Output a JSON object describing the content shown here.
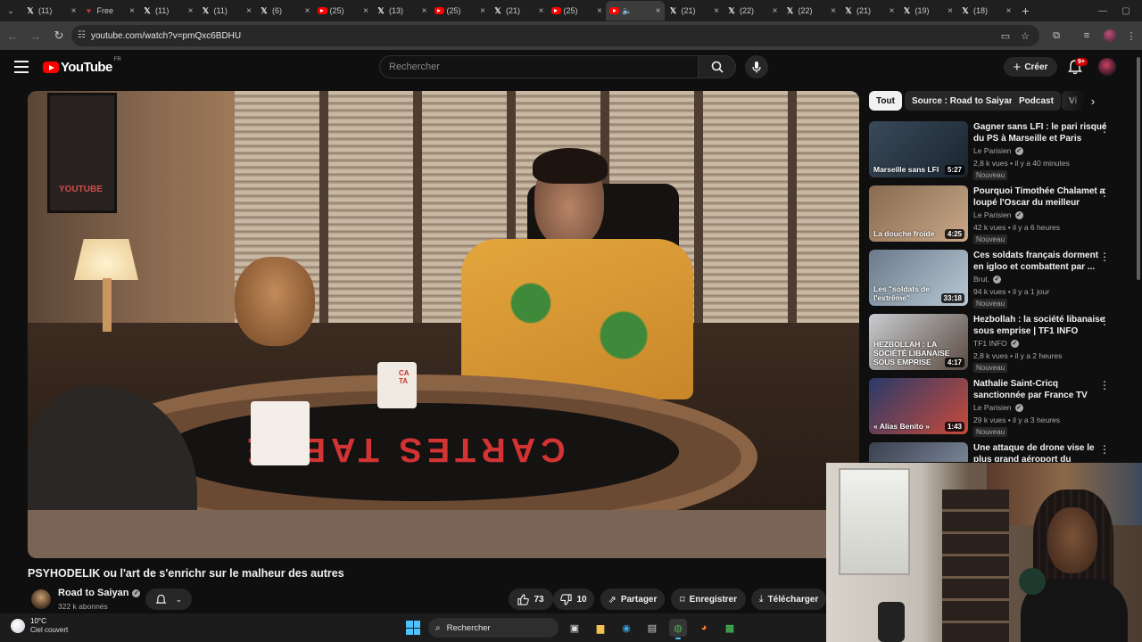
{
  "browser": {
    "tabs": [
      {
        "icon": "x-logo-icon",
        "label": "(11)"
      },
      {
        "icon": "heart-icon",
        "label": "Free"
      },
      {
        "icon": "x-logo-icon",
        "label": "(11)"
      },
      {
        "icon": "x-logo-icon",
        "label": "(11)"
      },
      {
        "icon": "x-logo-icon",
        "label": "(6)"
      },
      {
        "icon": "youtube-icon",
        "label": "(25)"
      },
      {
        "icon": "x-logo-icon",
        "label": "(13)"
      },
      {
        "icon": "youtube-icon",
        "label": "(25)"
      },
      {
        "icon": "x-logo-icon",
        "label": "(21)"
      },
      {
        "icon": "youtube-icon",
        "label": "(25)"
      },
      {
        "icon": "youtube-icon",
        "label": "",
        "active": true
      },
      {
        "icon": "x-logo-icon",
        "label": "(21)"
      },
      {
        "icon": "x-logo-icon",
        "label": "(22)"
      },
      {
        "icon": "x-logo-icon",
        "label": "(22)"
      },
      {
        "icon": "x-logo-icon",
        "label": "(21)"
      },
      {
        "icon": "x-logo-icon",
        "label": "(19)"
      },
      {
        "icon": "x-logo-icon",
        "label": "(18)"
      }
    ],
    "new_tab": "+",
    "close_glyph": "×",
    "url": "youtube.com/watch?v=pmQxc6BDHU"
  },
  "youtube": {
    "logo_text": "YouTube",
    "region": "FR",
    "search_placeholder": "Rechercher",
    "create_label": "Créer",
    "notifications_badge": "9+"
  },
  "video": {
    "title": "PSYHODELIK ou l'art de s'enrichr sur le malheur des autres",
    "channel": "Road to Saiyan",
    "subscribers": "322 k abonnés",
    "likes": "73",
    "dislikes": "10",
    "share_label": "Partager",
    "save_label": "Enregistrer",
    "download_label": "Télécharger",
    "scene_text": {
      "poster": "YOUTUBE",
      "table_brand": "CARTES TABLE",
      "mug": "CA TA"
    }
  },
  "chips": [
    "Tout",
    "Source : Road to Saiyan",
    "Podcast",
    "Vi"
  ],
  "recommendations": [
    {
      "title": "Gagner sans LFI : le pari risqué du PS à Marseille et Paris",
      "channel": "Le Parisien",
      "meta": "2,8 k vues • il y a 40 minutes",
      "badge": "Nouveau",
      "duration": "5:27",
      "thumb_text": "Marseille sans LFI",
      "thumb_colors": [
        "#3a4a5a",
        "#1a2430"
      ]
    },
    {
      "title": "Pourquoi Timothée Chalamet a loupé l'Oscar du meilleur acteur",
      "channel": "Le Parisien",
      "meta": "42 k vues • il y a 6 heures",
      "badge": "Nouveau",
      "duration": "4:25",
      "thumb_text": "La douche froide",
      "thumb_colors": [
        "#8a6a50",
        "#c8a888"
      ]
    },
    {
      "title": "Ces soldats français dorment en igloo et combattent par ...",
      "channel": "Brut.",
      "meta": "94 k vues • il y a 1 jour",
      "badge": "Nouveau",
      "duration": "33:18",
      "thumb_text": "Les \"soldats de l'extrême\"",
      "thumb_colors": [
        "#6a7a8a",
        "#b8c8d4"
      ]
    },
    {
      "title": "Hezbollah : la société libanaise sous emprise | TF1 INFO",
      "channel": "TF1 INFO",
      "meta": "2,8 k vues • il y a 2 heures",
      "badge": "Nouveau",
      "duration": "4:17",
      "thumb_text": "HEZBOLLAH : LA SOCIÉTÉ LIBANAISE SOUS EMPRISE",
      "thumb_colors": [
        "#c8ccd0",
        "#5a4a40"
      ]
    },
    {
      "title": "Nathalie Saint-Cricq sanctionnée par France TV po...",
      "channel": "Le Parisien",
      "meta": "29 k vues • il y a 3 heures",
      "badge": "Nouveau",
      "duration": "1:43",
      "thumb_text": "« Alias Benito »",
      "thumb_colors": [
        "#2a3a6a",
        "#c84a3a"
      ]
    },
    {
      "title": "Une attaque de drone vise le plus grand aéroport du monde...",
      "channel": "",
      "meta": "",
      "badge": "",
      "duration": "",
      "thumb_text": "",
      "thumb_colors": [
        "#3a4050",
        "#8a98a8"
      ]
    }
  ],
  "taskbar": {
    "temperature": "10°C",
    "weather": "Ciel couvert",
    "search_label": "Rechercher"
  }
}
